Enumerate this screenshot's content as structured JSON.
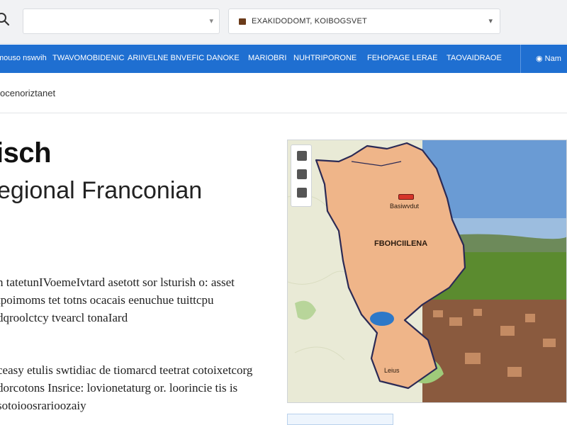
{
  "search": {
    "placeholder": "",
    "value": ""
  },
  "language_select": {
    "value": "EXAKIDODOMT, KOIBOGSVET"
  },
  "nav": {
    "items": [
      "mouso nswvih",
      "TWAVOMOBIDENIC",
      "ARIIVELNE BNVEFIC DANOKE",
      "MARIOBRI",
      "NUHTRIPORONE",
      "FEHOPAGE LERAE",
      "TAOVAIDRAOE"
    ],
    "account_label": "Nam"
  },
  "breadcrumb": "ocenoriztanet",
  "article": {
    "title": "isch",
    "subtitle": "egional Franconian",
    "paragraph1": "n tatetunIVoemeIvtard asetott sor lsturish o: asset tpoimoms tet totns ocacais eenuchue tuittcpu dqroolctcy tvearcl tonaIard",
    "paragraph2": "ceasy etulis swtidiac de tiomarcd teetrat cotoixetcorg dorcotons Insrice: lovionetaturg or. loorincie tis is sotoioosrarioozaiy"
  },
  "map": {
    "region_label": "FBOHCIILENA",
    "city_label": "Basiwvdut",
    "lower_label": "Leius",
    "colors": {
      "region": "#efb589",
      "border": "#2b2a55",
      "lake": "#2d78c8",
      "marker": "#d6352a",
      "sky": "#6a9bd4"
    }
  },
  "icons": {
    "search": "search-icon",
    "flag": "flag-icon",
    "account": "account-icon"
  },
  "colors": {
    "nav_bg": "#1f6fd1",
    "topbar_bg": "#f1f2f4"
  }
}
